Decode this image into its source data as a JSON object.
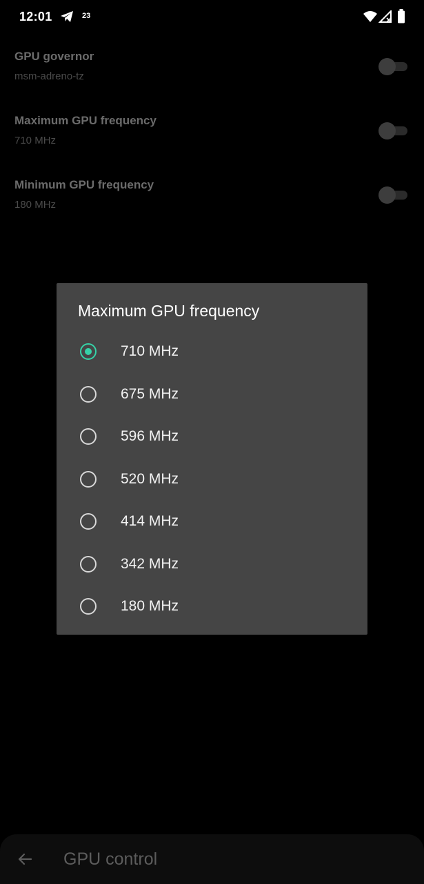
{
  "status_bar": {
    "time": "12:01",
    "notification_count": "23",
    "icons": [
      "telegram-icon",
      "wifi-icon",
      "signal-icon",
      "battery-icon"
    ]
  },
  "settings": [
    {
      "title": "GPU governor",
      "value": "msm-adreno-tz",
      "toggle_on": false
    },
    {
      "title": "Maximum GPU frequency",
      "value": "710 MHz",
      "toggle_on": false
    },
    {
      "title": "Minimum GPU frequency",
      "value": "180 MHz",
      "toggle_on": false
    }
  ],
  "dialog": {
    "title": "Maximum GPU frequency",
    "options": [
      "710 MHz",
      "675 MHz",
      "596 MHz",
      "520 MHz",
      "414 MHz",
      "342 MHz",
      "180 MHz"
    ],
    "selected": "710 MHz"
  },
  "bottom_bar": {
    "title": "GPU control",
    "back_icon": "arrow-left-icon"
  },
  "colors": {
    "accent": "#36d3a8",
    "dialog_bg": "#454545",
    "background": "#000000"
  }
}
